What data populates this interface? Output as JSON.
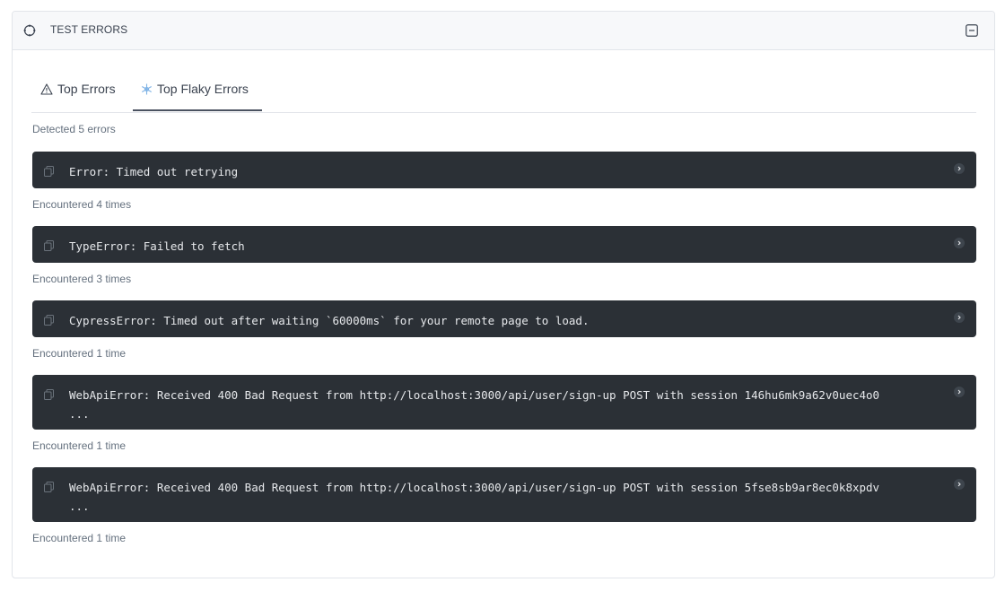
{
  "panel": {
    "title": "TEST ERRORS"
  },
  "tabs": [
    {
      "label": "Top Errors"
    },
    {
      "label": "Top Flaky Errors",
      "active": true
    }
  ],
  "summary": "Detected 5 errors",
  "errors": [
    {
      "message": "Error: Timed out retrying",
      "count_label": "Encountered 4 times"
    },
    {
      "message": "TypeError: Failed to fetch",
      "count_label": "Encountered 3 times"
    },
    {
      "message": "CypressError: Timed out after waiting `60000ms` for your remote page to load.",
      "count_label": "Encountered 1 time"
    },
    {
      "message": "WebApiError: Received 400 Bad Request from http://localhost:3000/api/user/sign-up POST with session 146hu6mk9a62v0uec4o0\n...",
      "count_label": "Encountered 1 time"
    },
    {
      "message": "WebApiError: Received 400 Bad Request from http://localhost:3000/api/user/sign-up POST with session 5fse8sb9ar8ec0k8xpdv\n...",
      "count_label": "Encountered 1 time"
    }
  ],
  "icons": {
    "header": "crosshair-icon",
    "collapse": "minus-square-icon",
    "tab_errors": "warning-triangle-icon",
    "tab_flaky": "snowflake-icon",
    "copy": "copy-icon",
    "expand": "chevron-right-icon"
  },
  "colors": {
    "card_bg": "#2b3036",
    "flaky_accent": "#7fb3e6",
    "header_bg": "#f7f8fa"
  }
}
